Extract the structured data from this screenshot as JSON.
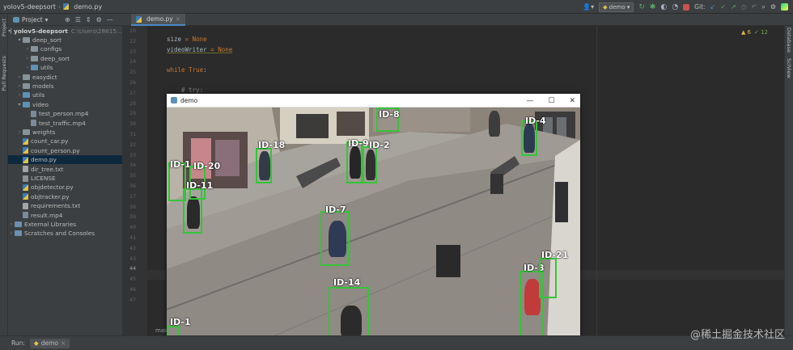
{
  "header": {
    "project": "yolov5-deepsort",
    "file": "demo.py",
    "run_config": "demo",
    "git_label": "Git:"
  },
  "toolbar": {
    "project_dropdown": "Project",
    "open_tab": "demo.py"
  },
  "sidebar_tabs": {
    "project": "Project",
    "pull_requests": "Pull Requests",
    "database": "Database",
    "sciview": "SciView"
  },
  "tree": {
    "root": "yolov5-deepsort",
    "root_path": "C:\\Users\\28615...",
    "items": [
      {
        "label": "deep_sort",
        "indent": 1,
        "kind": "folder",
        "expanded": true
      },
      {
        "label": "configs",
        "indent": 2,
        "kind": "folder"
      },
      {
        "label": "deep_sort",
        "indent": 2,
        "kind": "folder"
      },
      {
        "label": "utils",
        "indent": 2,
        "kind": "folder"
      },
      {
        "label": "easydict",
        "indent": 1,
        "kind": "folder"
      },
      {
        "label": "models",
        "indent": 1,
        "kind": "folder"
      },
      {
        "label": "utils",
        "indent": 1,
        "kind": "folder"
      },
      {
        "label": "video",
        "indent": 1,
        "kind": "folder",
        "expanded": true
      },
      {
        "label": "test_person.mp4",
        "indent": 2,
        "kind": "mp4"
      },
      {
        "label": "test_traffic.mp4",
        "indent": 2,
        "kind": "mp4"
      },
      {
        "label": "weights",
        "indent": 1,
        "kind": "folder"
      },
      {
        "label": "count_car.py",
        "indent": 1,
        "kind": "py"
      },
      {
        "label": "count_person.py",
        "indent": 1,
        "kind": "py"
      },
      {
        "label": "demo.py",
        "indent": 1,
        "kind": "py",
        "selected": true
      },
      {
        "label": "dir_tree.txt",
        "indent": 1,
        "kind": "txt"
      },
      {
        "label": "LICENSE",
        "indent": 1,
        "kind": "lic"
      },
      {
        "label": "objdetector.py",
        "indent": 1,
        "kind": "py"
      },
      {
        "label": "objtracker.py",
        "indent": 1,
        "kind": "py"
      },
      {
        "label": "requirements.txt",
        "indent": 1,
        "kind": "txt"
      },
      {
        "label": "result.mp4",
        "indent": 1,
        "kind": "mp4"
      },
      {
        "label": "External Libraries",
        "indent": 0,
        "kind": "lib"
      },
      {
        "label": "Scratches and Consoles",
        "indent": 0,
        "kind": "lib"
      }
    ]
  },
  "editor": {
    "line_numbers": [
      "20",
      "22",
      "23",
      "24",
      "25",
      "26",
      "27",
      "28",
      "29",
      "30",
      "31",
      "32",
      "33",
      "34",
      "35",
      "36",
      "37",
      "38",
      "39",
      "40",
      "41",
      "42",
      "43",
      "44",
      "45",
      "46",
      "47"
    ],
    "code": {
      "l1_var": "size",
      "l1_eq": " = ",
      "l1_val": "None",
      "l2_var": "videoWriter",
      "l2_eq": " = ",
      "l2_val": "None",
      "l3_kw": "while",
      "l3_val": " True",
      "l3_end": ":",
      "l4": "# try:"
    },
    "inspection_warnings": "▲ 6",
    "inspection_ok": "✓ 12",
    "bottom_crumb": "main"
  },
  "demo_window": {
    "title": "demo",
    "controls": [
      "—",
      "☐",
      "✕"
    ],
    "detections": [
      {
        "id": "ID-8"
      },
      {
        "id": "ID-4"
      },
      {
        "id": "ID-18"
      },
      {
        "id": "ID-9"
      },
      {
        "id": "ID-2"
      },
      {
        "id": "ID-1"
      },
      {
        "id": "ID-20"
      },
      {
        "id": "ID-11"
      },
      {
        "id": "ID-7"
      },
      {
        "id": "ID-14"
      },
      {
        "id": "ID-3"
      },
      {
        "id": "ID-21"
      },
      {
        "id": "ID-1"
      }
    ]
  },
  "bottom": {
    "run_label": "Run:",
    "run_tab": "demo"
  },
  "watermark": "@稀土掘金技术社区"
}
